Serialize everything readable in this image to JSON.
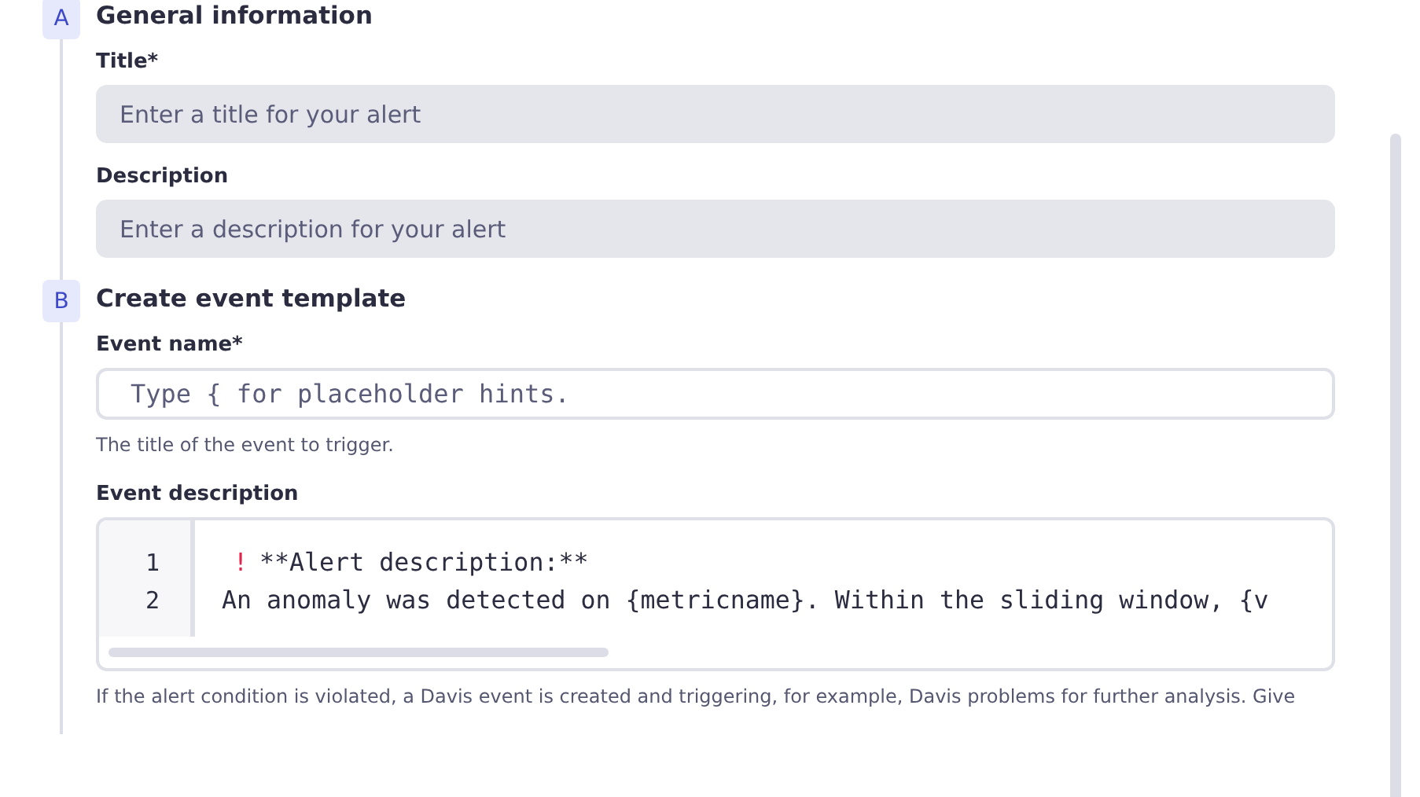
{
  "steps": [
    {
      "badge": "A",
      "title": "General information",
      "fields": [
        {
          "kind": "filled",
          "label": "Title*",
          "placeholder": "Enter a title for your alert"
        },
        {
          "kind": "filled",
          "label": "Description",
          "placeholder": "Enter a description for your alert"
        }
      ]
    },
    {
      "badge": "B",
      "title": "Create event template",
      "fields": [
        {
          "kind": "outlined",
          "label": "Event name*",
          "placeholder": "Type { for placeholder hints.",
          "help": "The title of the event to trigger."
        },
        {
          "kind": "code",
          "label": "Event description",
          "lines": [
            {
              "number": "1",
              "marker": "!",
              "text": "**Alert description:**"
            },
            {
              "number": "2",
              "text": "An anomaly was detected on {metricname}. Within the sliding window, {v"
            }
          ],
          "help": "If the alert condition is violated, a Davis event is created and triggering, for example, Davis problems for further analysis. Give"
        }
      ]
    }
  ]
}
